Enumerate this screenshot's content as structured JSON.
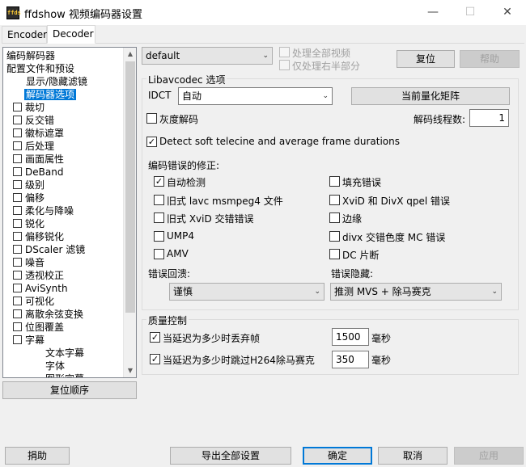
{
  "window": {
    "title": "ffdshow 视频编码器设置",
    "icon_text": "ffds",
    "minimize": "—",
    "maximize": "☐",
    "close": "✕"
  },
  "tabs": [
    {
      "label": "Encoder",
      "active": false
    },
    {
      "label": "Decoder",
      "active": true
    }
  ],
  "tree": {
    "items": [
      {
        "label": "编码解码器",
        "indent": 0,
        "checkbox": false,
        "selected": false
      },
      {
        "label": "配置文件和预设",
        "indent": 0,
        "checkbox": false,
        "selected": false
      },
      {
        "label": "显示/隐藏滤镜",
        "indent": 2,
        "checkbox": false,
        "selected": false
      },
      {
        "label": "解码器选项",
        "indent": 2,
        "checkbox": false,
        "selected": true
      },
      {
        "label": "裁切",
        "indent": 1,
        "checkbox": true,
        "selected": false
      },
      {
        "label": "反交错",
        "indent": 1,
        "checkbox": true,
        "selected": false
      },
      {
        "label": "徽标遮罩",
        "indent": 1,
        "checkbox": true,
        "selected": false
      },
      {
        "label": "后处理",
        "indent": 1,
        "checkbox": true,
        "selected": false
      },
      {
        "label": "画面属性",
        "indent": 1,
        "checkbox": true,
        "selected": false
      },
      {
        "label": "DeBand",
        "indent": 1,
        "checkbox": true,
        "selected": false
      },
      {
        "label": "级别",
        "indent": 1,
        "checkbox": true,
        "selected": false
      },
      {
        "label": "偏移",
        "indent": 1,
        "checkbox": true,
        "selected": false
      },
      {
        "label": "柔化与降噪",
        "indent": 1,
        "checkbox": true,
        "selected": false
      },
      {
        "label": "锐化",
        "indent": 1,
        "checkbox": true,
        "selected": false
      },
      {
        "label": "偏移锐化",
        "indent": 1,
        "checkbox": true,
        "selected": false
      },
      {
        "label": "DScaler 滤镜",
        "indent": 1,
        "checkbox": true,
        "selected": false
      },
      {
        "label": "噪音",
        "indent": 1,
        "checkbox": true,
        "selected": false
      },
      {
        "label": "透视校正",
        "indent": 1,
        "checkbox": true,
        "selected": false
      },
      {
        "label": "AviSynth",
        "indent": 1,
        "checkbox": true,
        "selected": false
      },
      {
        "label": "可视化",
        "indent": 1,
        "checkbox": true,
        "selected": false
      },
      {
        "label": "离散余弦变换",
        "indent": 1,
        "checkbox": true,
        "selected": false
      },
      {
        "label": "位图覆盖",
        "indent": 1,
        "checkbox": true,
        "selected": false
      },
      {
        "label": "字幕",
        "indent": 1,
        "checkbox": true,
        "selected": false
      },
      {
        "label": "文本字幕",
        "indent": 3,
        "checkbox": false,
        "selected": false
      },
      {
        "label": "字体",
        "indent": 3,
        "checkbox": false,
        "selected": false
      },
      {
        "label": "图形字幕",
        "indent": 3,
        "checkbox": false,
        "selected": false
      }
    ],
    "scroll_up": "▲",
    "scroll_down": "▼"
  },
  "reset_order_button": "复位顺序",
  "preset": {
    "value": "default",
    "process_all": "处理全部视频",
    "process_right_half": "仅处理右半部分",
    "reset_button": "复位",
    "help_button": "帮助"
  },
  "libavcodec": {
    "group_title": "Libavcodec 选项",
    "idct_label": "IDCT",
    "idct_value": "自动",
    "quant_matrix_button": "当前量化矩阵",
    "grayscale_label": "灰度解码",
    "grayscale_checked": false,
    "threads_label": "解码线程数:",
    "threads_value": "1",
    "telecine_label": "Detect soft telecine and average frame durations",
    "telecine_checked": true,
    "bug_fix_title": "编码错误的修正:",
    "bug_fixes_left": [
      {
        "label": "自动检测",
        "checked": true
      },
      {
        "label": "旧式 lavc msmpeg4 文件",
        "checked": false
      },
      {
        "label": "旧式 XviD 交错错误",
        "checked": false
      },
      {
        "label": "UMP4",
        "checked": false
      },
      {
        "label": "AMV",
        "checked": false
      }
    ],
    "bug_fixes_right": [
      {
        "label": "填充错误",
        "checked": false
      },
      {
        "label": "XviD 和 DivX qpel 错误",
        "checked": false
      },
      {
        "label": "边缘",
        "checked": false
      },
      {
        "label": "divx 交错色度 MC 错误",
        "checked": false
      },
      {
        "label": "DC 片断",
        "checked": false
      }
    ],
    "error_resilience_label": "错误回溃:",
    "error_resilience_value": "谨慎",
    "error_concealment_label": "错误隐藏:",
    "error_concealment_value": "推测 MVS + 除马赛克"
  },
  "quality": {
    "group_title": "质量控制",
    "drop_label": "当延迟为多少时丢弃帧",
    "drop_checked": true,
    "drop_value": "1500",
    "drop_unit": "毫秒",
    "skip_label": "当延迟为多少时跳过H264除马赛克",
    "skip_checked": true,
    "skip_value": "350",
    "skip_unit": "毫秒"
  },
  "bottom": {
    "donate": "捐助",
    "export": "导出全部设置",
    "ok": "确定",
    "cancel": "取消",
    "apply": "应用"
  },
  "check_mark": "✓",
  "combo_arrow": "⌄"
}
